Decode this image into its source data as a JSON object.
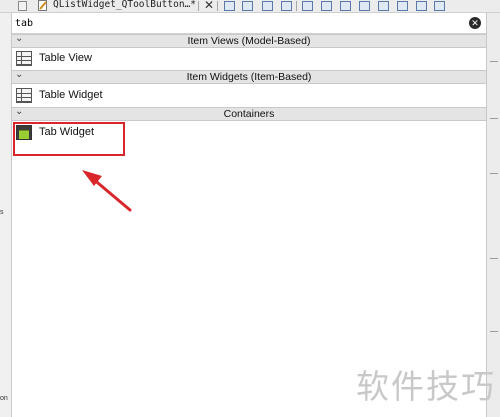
{
  "toolbar": {
    "document_title": "QListWidget_QToolButton…*",
    "close_glyph": "✕"
  },
  "filter": {
    "value": "tab",
    "clear_glyph": "✕"
  },
  "widget_box": {
    "categories": [
      {
        "label": "Item Views (Model-Based)",
        "items": [
          {
            "label": "Table View",
            "icon": "table-icon"
          }
        ]
      },
      {
        "label": "Item Widgets (Item-Based)",
        "items": [
          {
            "label": "Table Widget",
            "icon": "table-icon"
          }
        ]
      },
      {
        "label": "Containers",
        "items": [
          {
            "label": "Tab Widget",
            "icon": "tab-widget-icon"
          }
        ]
      }
    ]
  },
  "left_panel": {
    "cut_text_1": "s",
    "cut_text_2": "on"
  },
  "watermark": "软件技巧",
  "colors": {
    "highlight": "#d9262a",
    "category_bg": "#e4e4e4",
    "tab_icon_green": "#9acd32"
  }
}
